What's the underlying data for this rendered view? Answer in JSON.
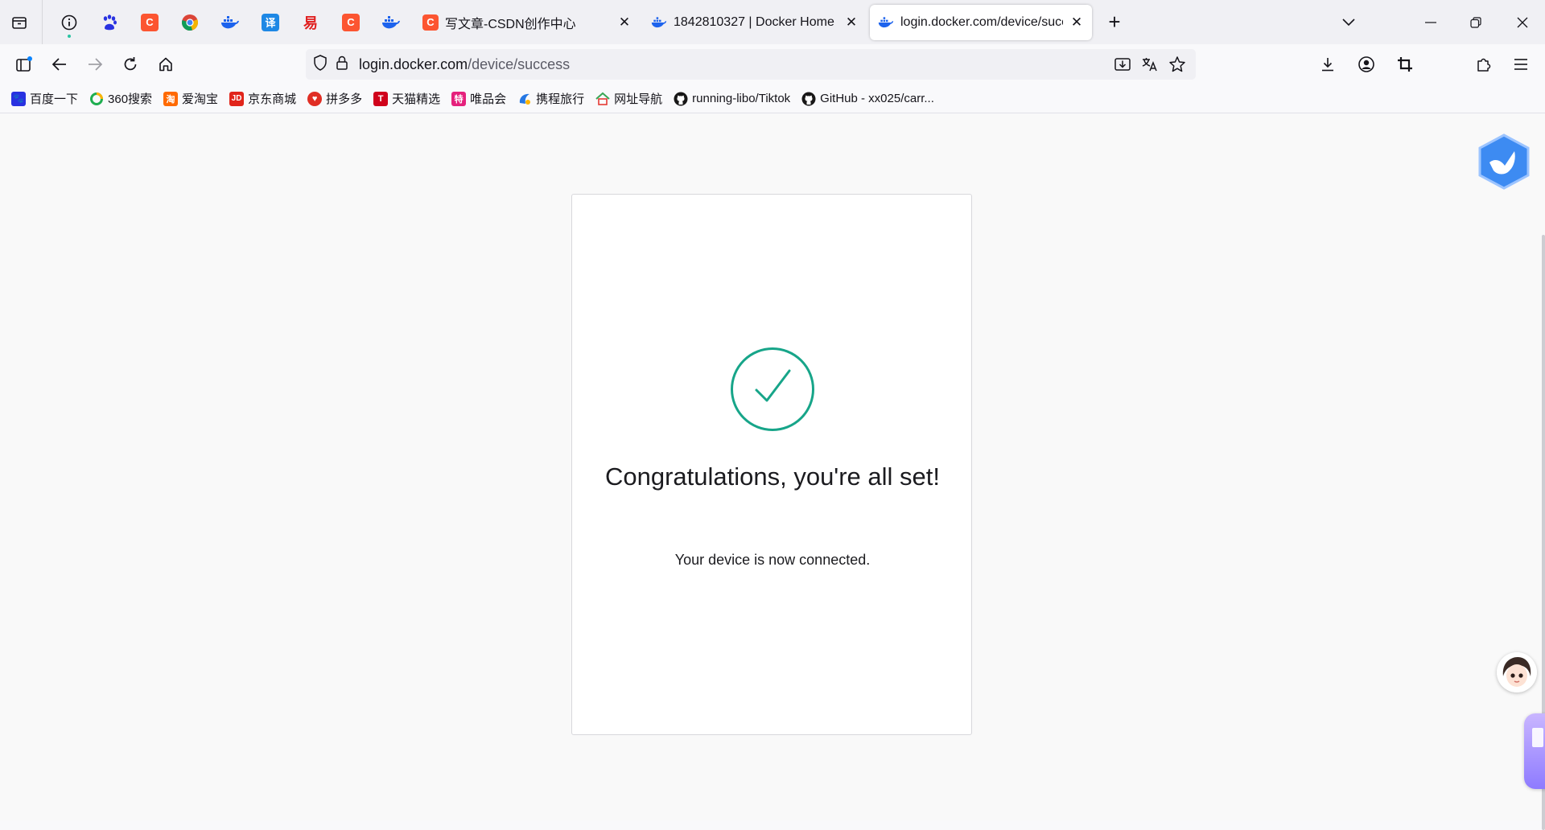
{
  "tabs": [
    {
      "title": "写文章-CSDN创作中心",
      "favicon": "csdn-icon",
      "active": false
    },
    {
      "title": "1842810327 | Docker Home",
      "favicon": "docker-icon",
      "active": false
    },
    {
      "title": "login.docker.com/device/succ",
      "favicon": "docker-icon",
      "active": true
    }
  ],
  "pinned_tabs": [
    "info-icon",
    "baidu-icon",
    "csdn-icon",
    "chrome-icon",
    "docker-icon",
    "translate-icon",
    "yi-icon",
    "csdn-icon",
    "docker-icon"
  ],
  "pinned_translate_glyph": "译",
  "pinned_yi_glyph": "易",
  "url": {
    "host": "login.docker.com",
    "path": "/device/success"
  },
  "bookmarks": [
    {
      "label": "百度一下",
      "icon": "baidu-icon",
      "color": "#2932e1",
      "glyph": ""
    },
    {
      "label": "360搜索",
      "icon": "360-icon",
      "color": "#1fae50",
      "glyph": ""
    },
    {
      "label": "爱淘宝",
      "icon": "taobao-icon",
      "color": "#ff6a00",
      "glyph": "淘"
    },
    {
      "label": "京东商城",
      "icon": "jd-icon",
      "color": "#e1251b",
      "glyph": "JD"
    },
    {
      "label": "拼多多",
      "icon": "pdd-icon",
      "color": "#e02e24",
      "glyph": ""
    },
    {
      "label": "天猫精选",
      "icon": "tmall-icon",
      "color": "#d0021b",
      "glyph": "T"
    },
    {
      "label": "唯品会",
      "icon": "vip-icon",
      "color": "#e5217c",
      "glyph": "特"
    },
    {
      "label": "携程旅行",
      "icon": "ctrip-icon",
      "color": "#2577e3",
      "glyph": ""
    },
    {
      "label": "网址导航",
      "icon": "nav-icon",
      "color": "#3aa757",
      "glyph": ""
    },
    {
      "label": "running-libo/Tiktok",
      "icon": "github-icon",
      "color": "#181717",
      "glyph": ""
    },
    {
      "label": "GitHub - xx025/carr...",
      "icon": "github-icon",
      "color": "#181717",
      "glyph": ""
    }
  ],
  "card": {
    "title": "Congratulations, you're all set!",
    "subtitle": "Your device is now connected.",
    "check_color": "#17a589"
  }
}
